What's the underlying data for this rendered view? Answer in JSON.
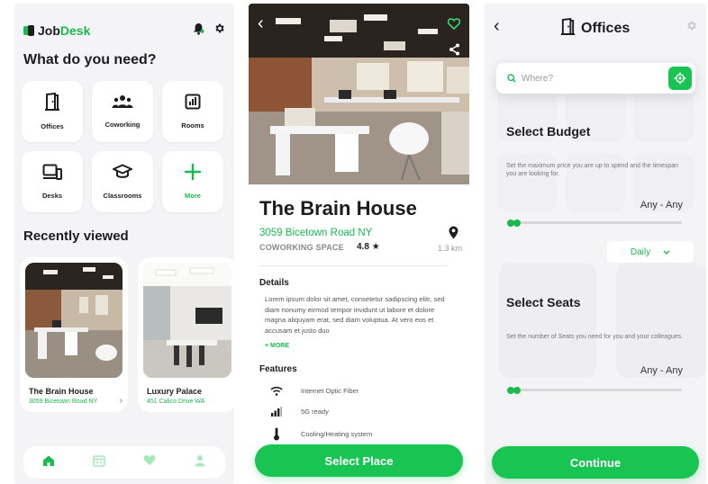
{
  "colors": {
    "brand": "#1aba4e",
    "button": "#19c552",
    "text": "#1d1d1f",
    "muted": "#888888"
  },
  "home": {
    "logo": {
      "part1": "Job",
      "part2": "Desk"
    },
    "top_icons": [
      "bell-icon",
      "gear-icon"
    ],
    "title": "What do you need?",
    "categories": [
      {
        "label": "Offices",
        "icon": "door-icon"
      },
      {
        "label": "Coworking",
        "icon": "people-icon"
      },
      {
        "label": "Rooms",
        "icon": "room-icon"
      },
      {
        "label": "Desks",
        "icon": "desk-icon"
      },
      {
        "label": "Classrooms",
        "icon": "graduation-cap-icon"
      },
      {
        "label": "More",
        "icon": "plus-icon"
      }
    ],
    "recently_viewed_title": "Recently viewed",
    "recent": [
      {
        "name": "The Brain House",
        "address": "3059 Bicetown Road NY"
      },
      {
        "name": "Luxury Palace",
        "address": "451 Calico Drive WA"
      }
    ],
    "nav": [
      "home-icon",
      "calendar-icon",
      "heart-icon",
      "user-icon"
    ]
  },
  "detail": {
    "title": "The Brain House",
    "address": "3059 Bicetown Road NY",
    "type": "COWORKING SPACE",
    "rating": "4.8",
    "distance": "1.3 km",
    "details_label": "Details",
    "details_text": "Lorem ipsum dolor sit amet, consetetur sadipscing elitr, sed diam nonumy eirmod tempor invidunt ut labore et dolore magna aliquyam erat, sed diam voluptua. At vero eos et accusam et justo duo",
    "more_label": "+ MORE",
    "features_label": "Features",
    "features": [
      {
        "label": "Internet Optic Fiber",
        "icon": "wifi-icon"
      },
      {
        "label": "5G ready",
        "icon": "signal-icon"
      },
      {
        "label": "Cooling/Heating system",
        "icon": "thermometer-icon"
      }
    ],
    "cta": "Select Place"
  },
  "filters": {
    "title": "Offices",
    "search_placeholder": "Where?",
    "budget": {
      "title": "Select Budget",
      "desc": "Set the maximum price you are up to spend and the timespan you are looking for.",
      "value": "Any - Any",
      "slider_fraction": 0.05,
      "period": "Daily"
    },
    "seats": {
      "title": "Select Seats",
      "desc": "Set the number of Seats you need for you and your colleagues.",
      "value": "Any - Any",
      "slider_fraction": 0.05
    },
    "cta": "Continue"
  }
}
